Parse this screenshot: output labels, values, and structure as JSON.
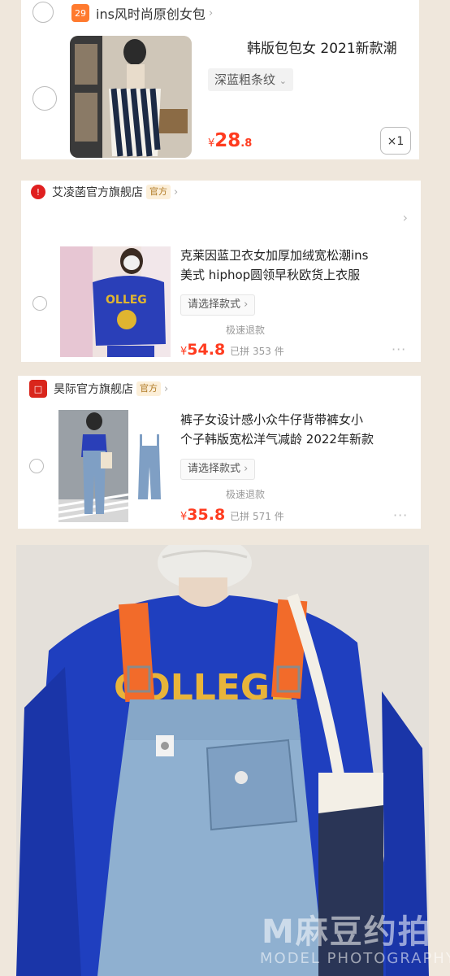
{
  "cart": {
    "items": [
      {
        "shop_name": "ins风时尚原创女包",
        "title": "韩版包包女 2021新款潮",
        "sku": "深蓝粗条纹",
        "price_symbol": "¥",
        "price_int": "28",
        "price_dec": ".8",
        "quantity": "×1"
      },
      {
        "shop_name": "艾凌菡官方旗舰店",
        "shop_badge": "官方",
        "title_line1": "克莱因蓝卫衣女加厚加绒宽松潮ins",
        "title_line2": "美式 hiphop圆领早秋欧货上衣服",
        "sku": "请选择款式",
        "service": "极速退款",
        "price_symbol": "¥",
        "price_value": "54.8",
        "sold": "已拼 353 件"
      },
      {
        "shop_name": "昊际官方旗舰店",
        "shop_badge": "官方",
        "title_line1": "裤子女设计感小众牛仔背带裤女小",
        "title_line2": "个子韩版宽松洋气减龄 2022年新款",
        "sku": "请选择款式",
        "service": "极速退款",
        "price_symbol": "¥",
        "price_value": "35.8",
        "sold": "已拼 571 件"
      }
    ]
  },
  "photo": {
    "shirt_text": "COLLEGE",
    "watermark_logo": "M麻豆约拍",
    "watermark_sub": "MODEL PHOTOGRAPHY"
  },
  "colors": {
    "price": "#ff3b1f",
    "background": "#efe7dc",
    "shirt_blue": "#1f3fbf",
    "strap_orange": "#f26b2a",
    "denim": "#8fb0d0"
  },
  "icons": [
    "store-icon",
    "chevron-right-icon",
    "chevron-down-icon",
    "official-store-icon",
    "more-icon"
  ]
}
